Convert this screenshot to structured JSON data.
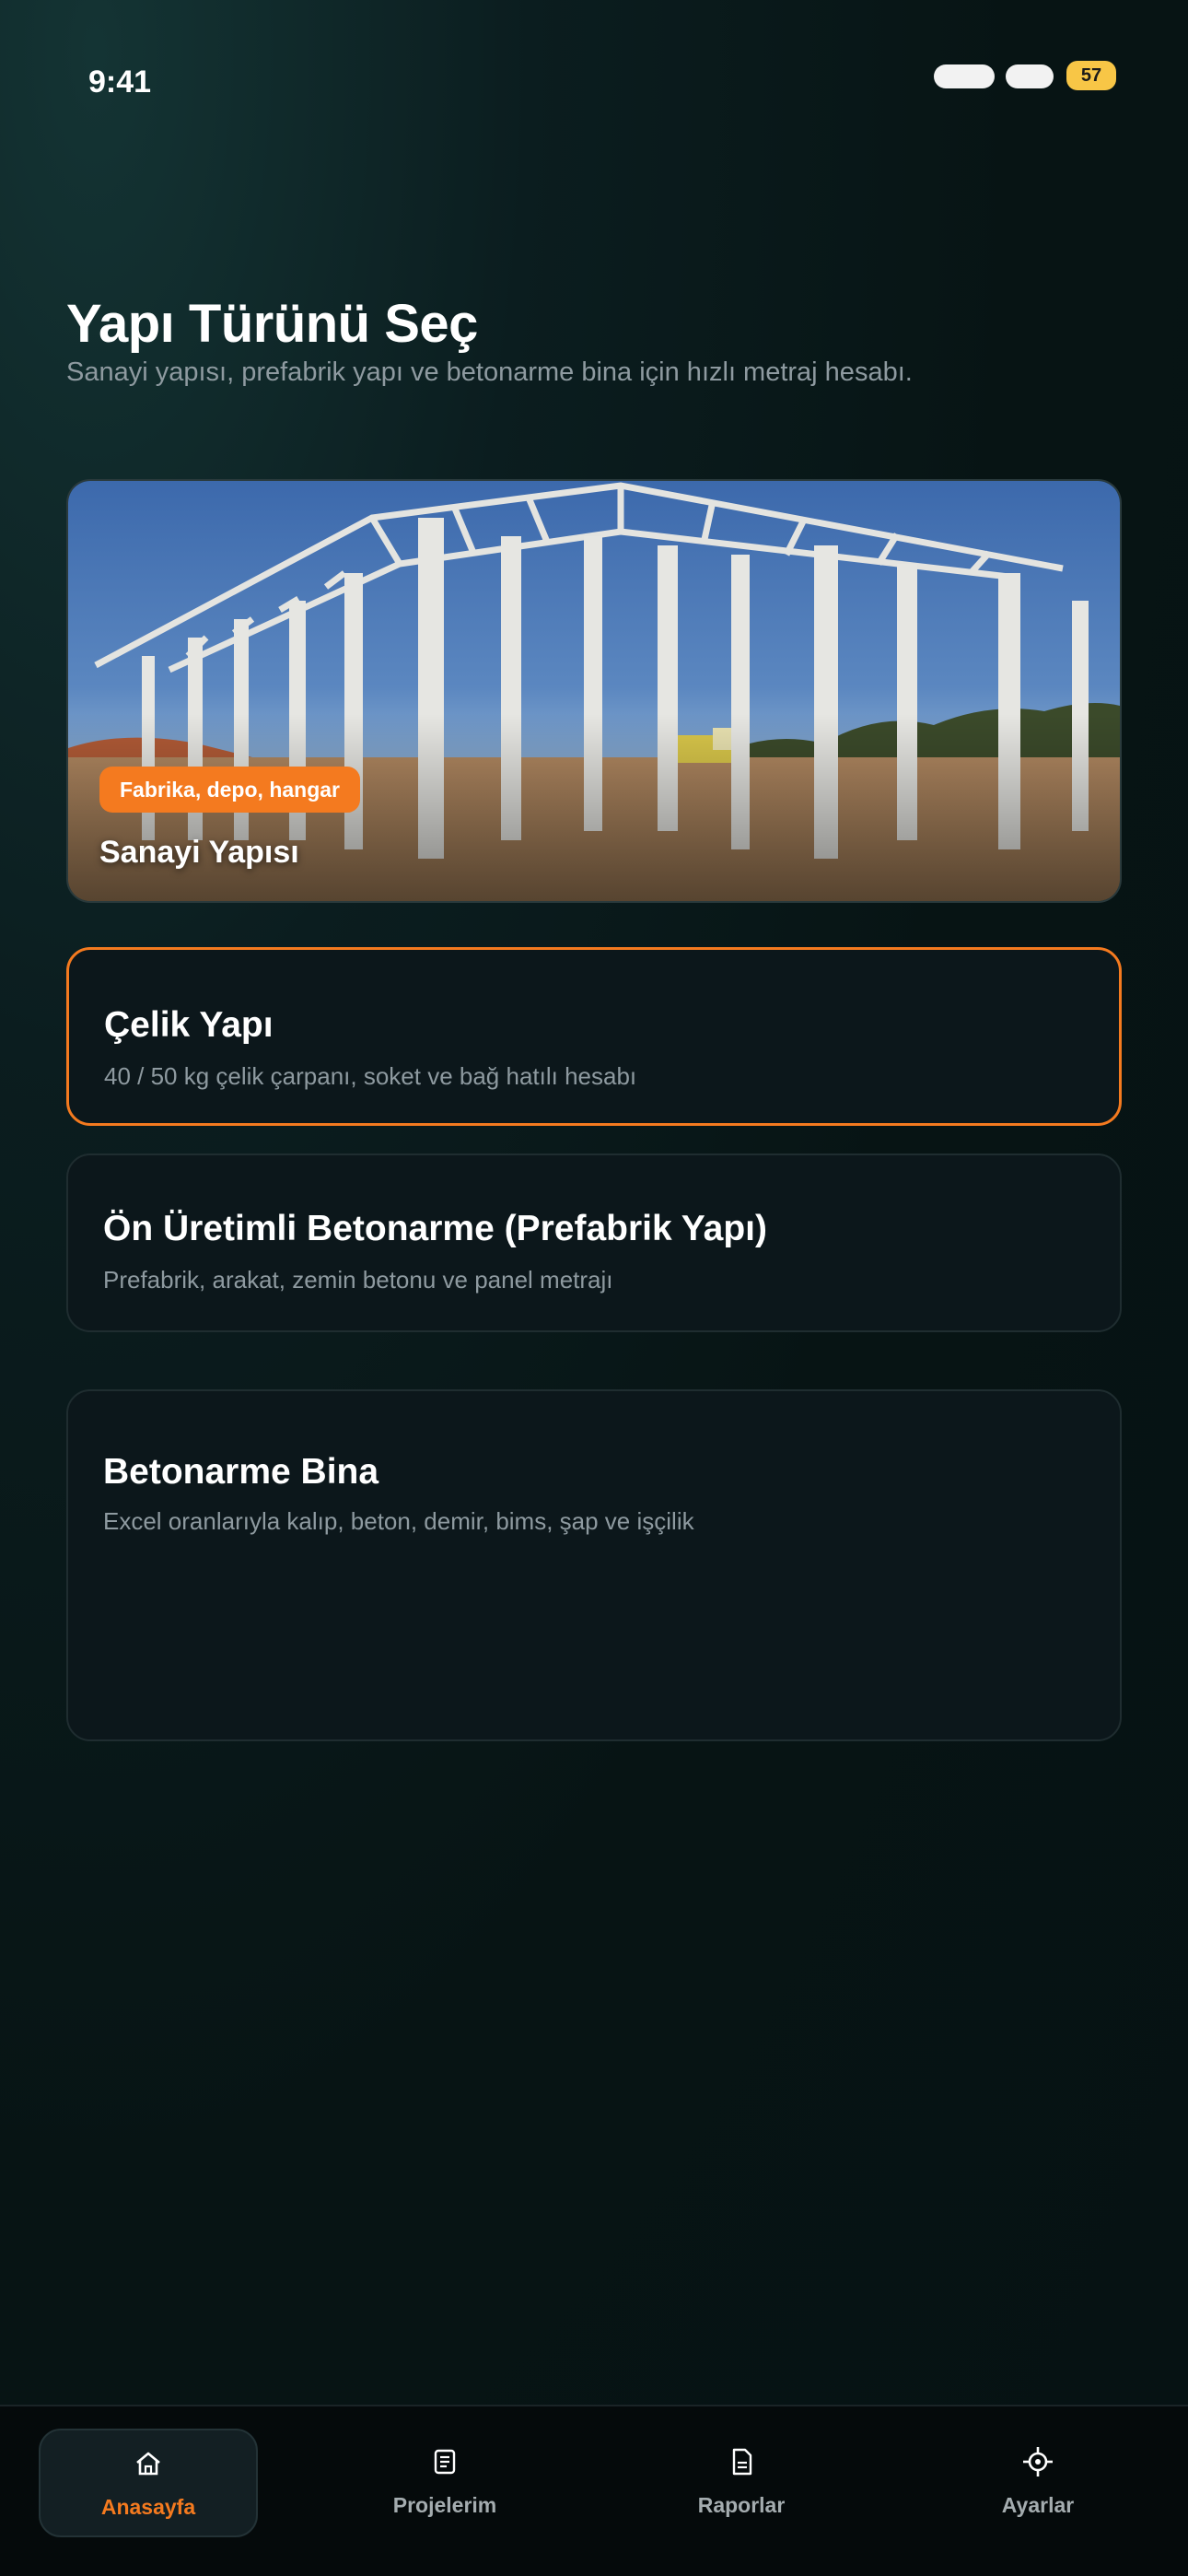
{
  "status": {
    "time": "9:41",
    "battery": "57"
  },
  "header": {
    "title": "Yapı Türünü Seç",
    "subtitle": "Sanayi yapısı, prefabrik yapı ve betonarme bina için hızlı metraj hesabı."
  },
  "hero": {
    "badge": "Fabrika, depo, hangar",
    "title": "Sanayi Yapısı"
  },
  "cards": [
    {
      "title": "Çelik Yapı",
      "desc": "40 / 50 kg çelik çarpanı, soket ve bağ hatılı hesabı",
      "selected": true
    },
    {
      "title": "Ön Üretimli Betonarme (Prefabrik Yapı)",
      "desc": "Prefabrik, arakat, zemin betonu ve panel metrajı",
      "selected": false
    },
    {
      "title": "Betonarme Bina",
      "desc": "Excel oranlarıyla kalıp, beton, demir, bims, şap ve işçilik",
      "selected": false
    }
  ],
  "tabs": [
    {
      "label": "Anasayfa",
      "icon": "home-icon",
      "active": true
    },
    {
      "label": "Projelerim",
      "icon": "list-icon",
      "active": false
    },
    {
      "label": "Raporlar",
      "icon": "document-icon",
      "active": false
    },
    {
      "label": "Ayarlar",
      "icon": "settings-crosshair-icon",
      "active": false
    }
  ],
  "colors": {
    "accent": "#f47a1f",
    "background": "#071414",
    "card": "#0c171b",
    "battery": "#f8c646"
  }
}
